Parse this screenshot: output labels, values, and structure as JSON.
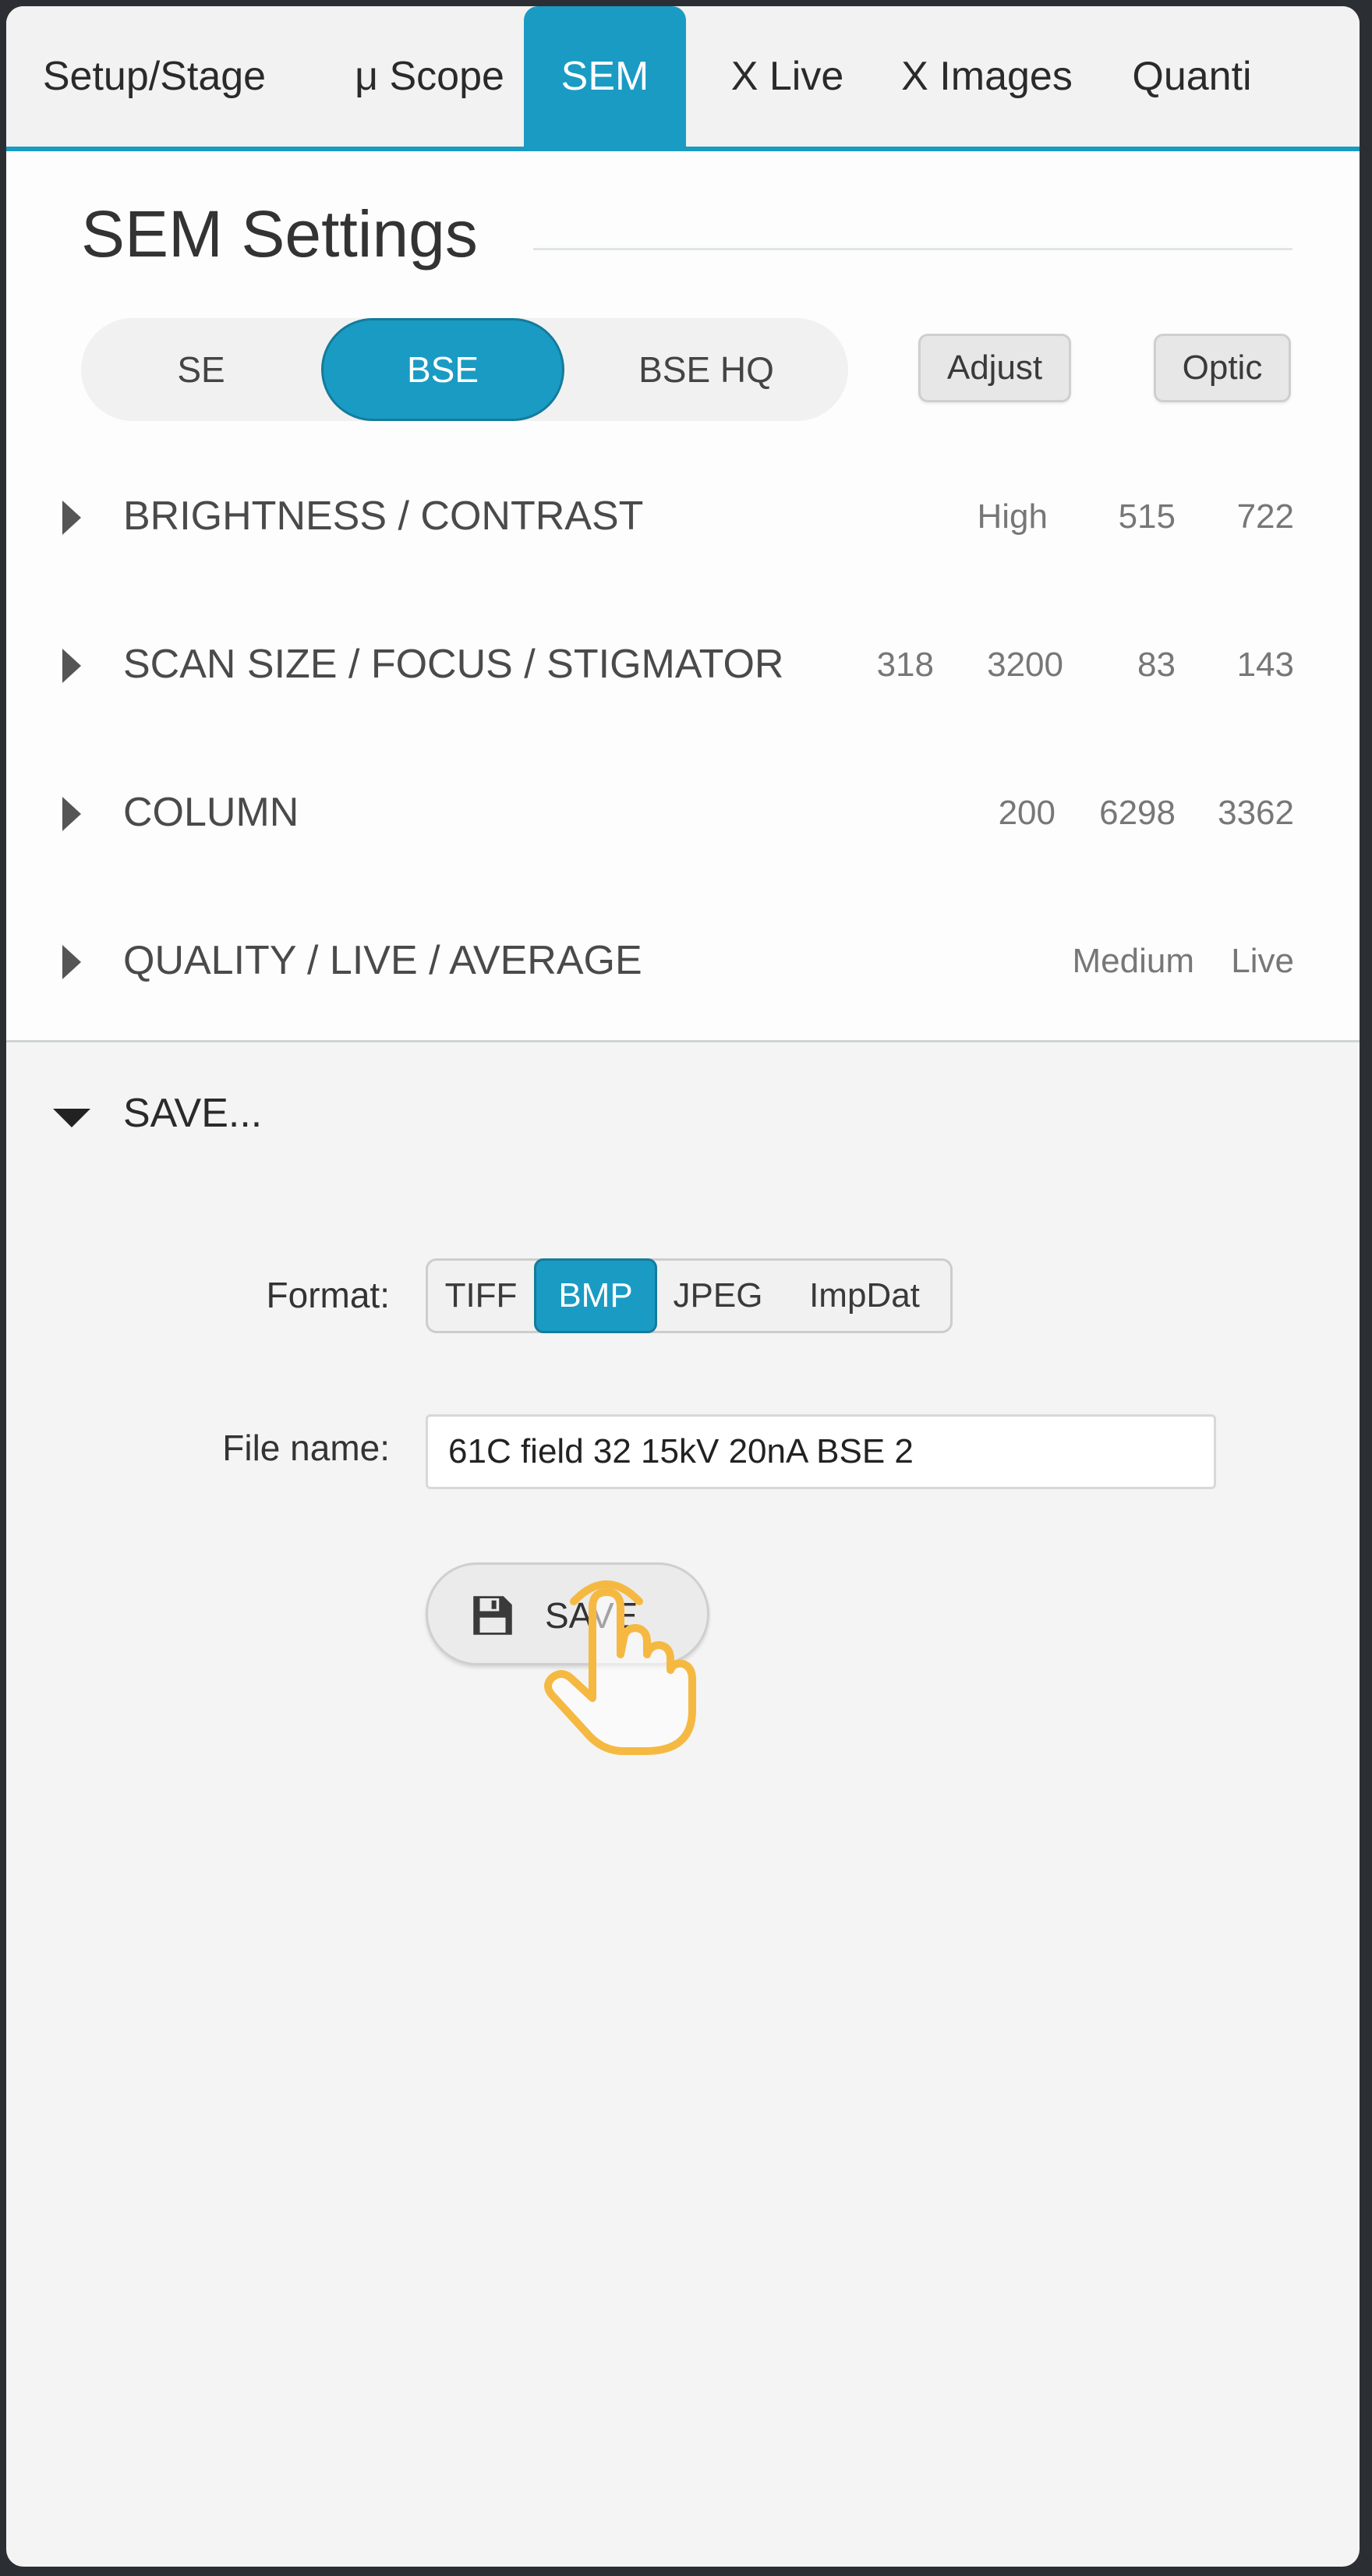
{
  "tabs": [
    {
      "label": "Setup/Stage",
      "active": false
    },
    {
      "label": "μ Scope",
      "active": false
    },
    {
      "label": "SEM",
      "active": true
    },
    {
      "label": "X Live",
      "active": false
    },
    {
      "label": "X Images",
      "active": false
    },
    {
      "label": "Quanti",
      "active": false
    }
  ],
  "panel": {
    "title": "SEM Settings",
    "detector_modes": [
      {
        "label": "SE",
        "active": false
      },
      {
        "label": "BSE",
        "active": true
      },
      {
        "label": "BSE HQ",
        "active": false
      }
    ],
    "adjust_label": "Adjust",
    "optic_label": "Optic",
    "sections": [
      {
        "label": "BRIGHTNESS / CONTRAST",
        "values": [
          "High",
          "515",
          "722"
        ]
      },
      {
        "label": "SCAN SIZE / FOCUS / STIGMATOR",
        "values": [
          "318",
          "3200",
          "83",
          "143"
        ]
      },
      {
        "label": "COLUMN",
        "values": [
          "200",
          "6298",
          "3362"
        ]
      },
      {
        "label": "QUALITY / LIVE / AVERAGE",
        "values": [
          "Medium",
          "Live"
        ]
      }
    ]
  },
  "save": {
    "header": "SAVE...",
    "format_label": "Format:",
    "formats": [
      {
        "label": "TIFF",
        "active": false
      },
      {
        "label": "BMP",
        "active": true
      },
      {
        "label": "JPEG",
        "active": false
      },
      {
        "label": "ImpDat",
        "active": false
      }
    ],
    "filename_label": "File name:",
    "filename_value": "61C field 32 15kV 20nA BSE 2",
    "button_label": "SAVE"
  },
  "colors": {
    "accent": "#1a9bc3",
    "cursor": "#f5b942"
  },
  "icons": [
    "floppy-disk-icon",
    "caret-right-icon",
    "caret-down-icon",
    "hand-pointer-icon"
  ]
}
